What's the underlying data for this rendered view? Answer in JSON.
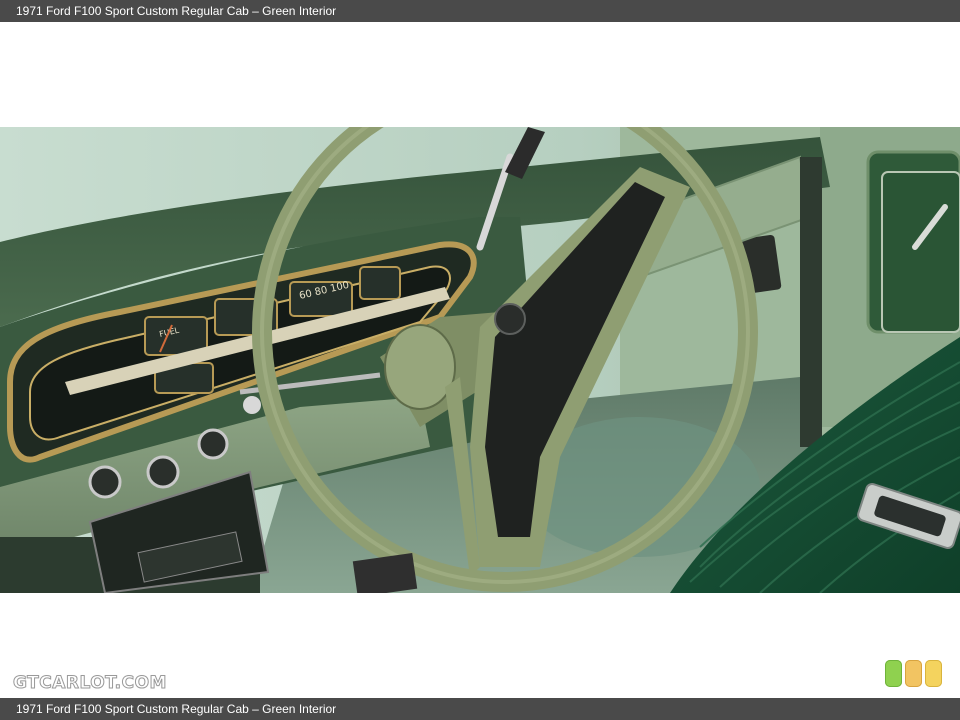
{
  "header": {
    "caption": "1971 Ford F100 Sport Custom Regular Cab – Green Interior"
  },
  "footer": {
    "caption": "1971 Ford F100 Sport Custom Regular Cab – Green Interior"
  },
  "site": {
    "logo_text": "GTCARLOT.COM"
  },
  "photo": {
    "subject": "steering-wheel-and-dashboard",
    "palette": {
      "wheel": "#8f9e72",
      "dash": "#3f5e45",
      "trim": "#b79a55",
      "seat": "#1e5b3f",
      "floor": "#7f9c87"
    },
    "gauges": {
      "speedometer_ticks": "60 80 100",
      "fuel_label": "FUEL"
    }
  },
  "rating_lights": {
    "colors": [
      "#8fd14f",
      "#f2c462",
      "#f4d35e"
    ],
    "icon": "traffic-light-icon"
  }
}
